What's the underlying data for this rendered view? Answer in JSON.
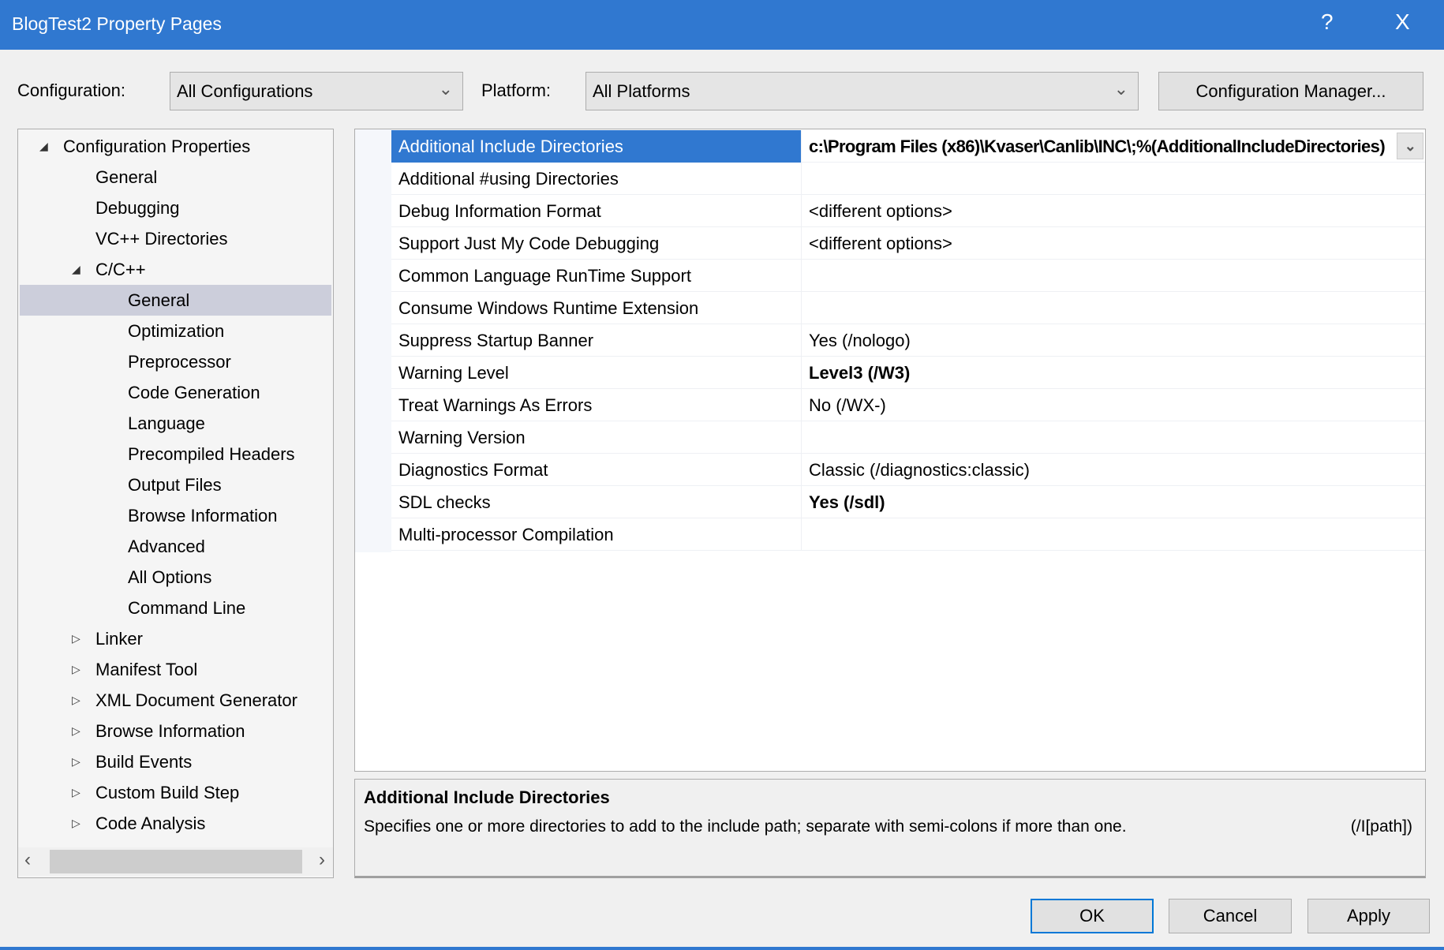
{
  "window": {
    "title": "BlogTest2 Property Pages",
    "help": "?",
    "close": "X"
  },
  "toolbar": {
    "configuration_label": "Configuration:",
    "configuration_value": "All Configurations",
    "platform_label": "Platform:",
    "platform_value": "All Platforms",
    "config_manager": "Configuration Manager..."
  },
  "tree": {
    "items": [
      {
        "label": "Configuration Properties",
        "level": 0,
        "expander": "expanded"
      },
      {
        "label": "General",
        "level": 1,
        "expander": ""
      },
      {
        "label": "Debugging",
        "level": 1,
        "expander": ""
      },
      {
        "label": "VC++ Directories",
        "level": 1,
        "expander": ""
      },
      {
        "label": "C/C++",
        "level": 1,
        "expander": "expanded"
      },
      {
        "label": "General",
        "level": 2,
        "expander": "",
        "selected": true
      },
      {
        "label": "Optimization",
        "level": 2,
        "expander": ""
      },
      {
        "label": "Preprocessor",
        "level": 2,
        "expander": ""
      },
      {
        "label": "Code Generation",
        "level": 2,
        "expander": ""
      },
      {
        "label": "Language",
        "level": 2,
        "expander": ""
      },
      {
        "label": "Precompiled Headers",
        "level": 2,
        "expander": ""
      },
      {
        "label": "Output Files",
        "level": 2,
        "expander": ""
      },
      {
        "label": "Browse Information",
        "level": 2,
        "expander": ""
      },
      {
        "label": "Advanced",
        "level": 2,
        "expander": ""
      },
      {
        "label": "All Options",
        "level": 2,
        "expander": ""
      },
      {
        "label": "Command Line",
        "level": 2,
        "expander": ""
      },
      {
        "label": "Linker",
        "level": 1,
        "expander": "collapsed"
      },
      {
        "label": "Manifest Tool",
        "level": 1,
        "expander": "collapsed"
      },
      {
        "label": "XML Document Generator",
        "level": 1,
        "expander": "collapsed"
      },
      {
        "label": "Browse Information",
        "level": 1,
        "expander": "collapsed"
      },
      {
        "label": "Build Events",
        "level": 1,
        "expander": "collapsed"
      },
      {
        "label": "Custom Build Step",
        "level": 1,
        "expander": "collapsed"
      },
      {
        "label": "Code Analysis",
        "level": 1,
        "expander": "collapsed"
      }
    ]
  },
  "grid": {
    "rows": [
      {
        "name": "Additional Include Directories",
        "value": "c:\\Program Files (x86)\\Kvaser\\Canlib\\INC\\;%(AdditionalIncludeDirectories)",
        "selected": true
      },
      {
        "name": "Additional #using Directories",
        "value": ""
      },
      {
        "name": "Debug Information Format",
        "value": "<different options>"
      },
      {
        "name": "Support Just My Code Debugging",
        "value": "<different options>"
      },
      {
        "name": "Common Language RunTime Support",
        "value": ""
      },
      {
        "name": "Consume Windows Runtime Extension",
        "value": ""
      },
      {
        "name": "Suppress Startup Banner",
        "value": "Yes (/nologo)"
      },
      {
        "name": "Warning Level",
        "value": "Level3 (/W3)",
        "bold": true
      },
      {
        "name": "Treat Warnings As Errors",
        "value": "No (/WX-)"
      },
      {
        "name": "Warning Version",
        "value": ""
      },
      {
        "name": "Diagnostics Format",
        "value": "Classic (/diagnostics:classic)"
      },
      {
        "name": "SDL checks",
        "value": "Yes (/sdl)",
        "bold": true
      },
      {
        "name": "Multi-processor Compilation",
        "value": ""
      }
    ]
  },
  "description": {
    "title": "Additional Include Directories",
    "text": "Specifies one or more directories to add to the include path; separate with semi-colons if more than one.",
    "switch": "(/I[path])"
  },
  "buttons": {
    "ok": "OK",
    "cancel": "Cancel",
    "apply": "Apply"
  },
  "colors": {
    "titlebar": "#3078d0",
    "selection": "#3078d0",
    "tree_selection": "#cccedb"
  }
}
